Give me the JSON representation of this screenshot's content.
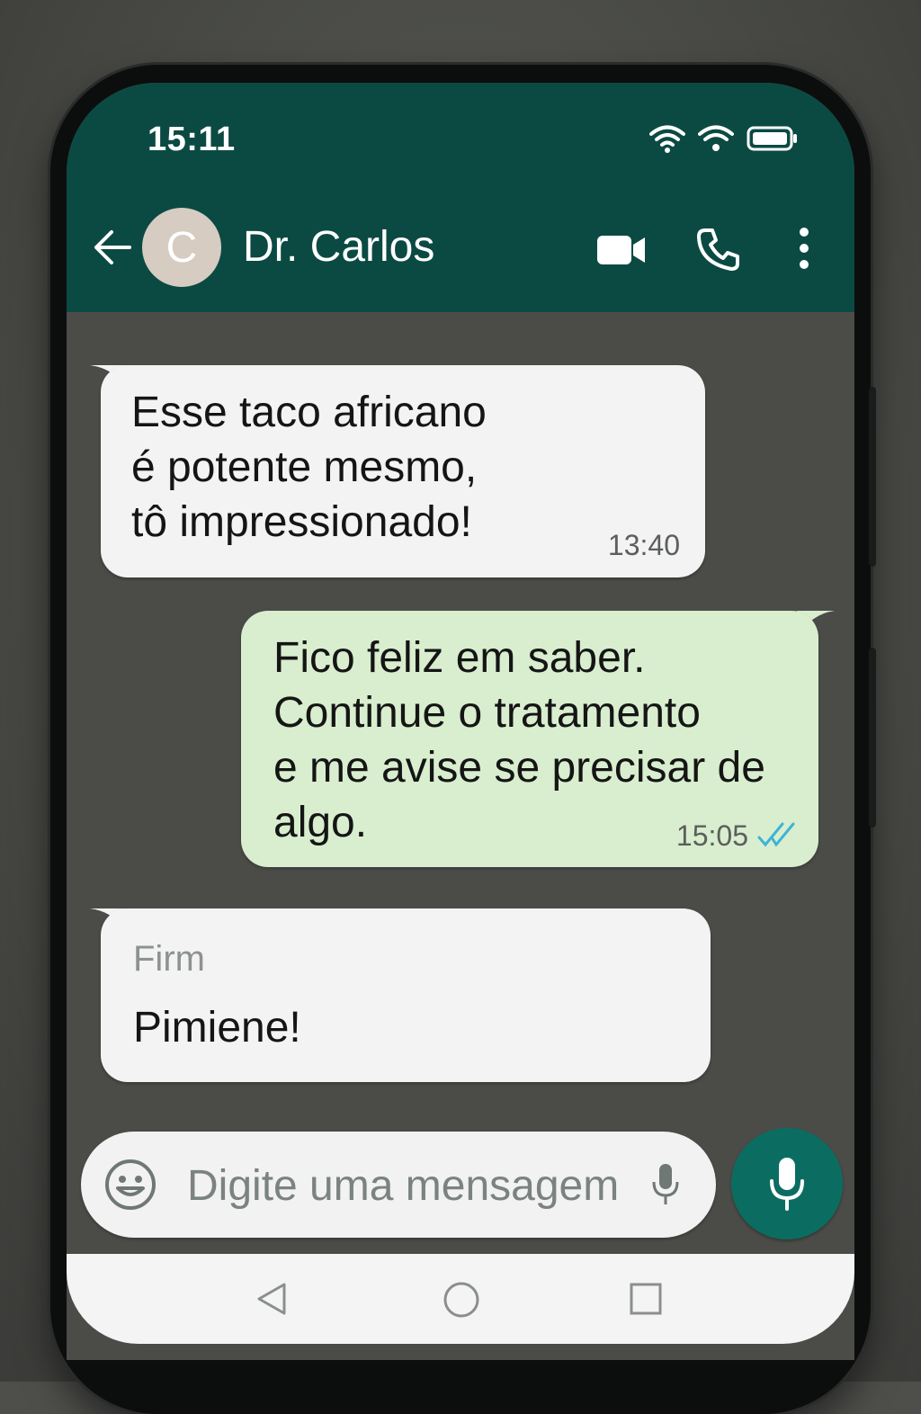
{
  "status_bar": {
    "time": "15:11"
  },
  "header": {
    "avatar_letter": "C",
    "contact_name": "Dr. Carlos",
    "icons": [
      "back-arrow-icon",
      "video-call-icon",
      "voice-call-icon",
      "more-options-icon"
    ]
  },
  "messages": [
    {
      "direction": "incoming",
      "text": "Esse taco africano\né potente mesmo,\ntô impressionado!",
      "time": "13:40"
    },
    {
      "direction": "outgoing",
      "text": "Fico feliz em saber.\nContinue o tratamento\ne me avise se precisar de\nalgo.",
      "time": "15:05",
      "status": "read"
    },
    {
      "direction": "incoming",
      "sender": "Firm",
      "text": "Pimiene!"
    }
  ],
  "composer": {
    "placeholder": "Digite uma mensagem"
  },
  "colors": {
    "header": "#0b4a43",
    "chat_background": "#4b4c48",
    "incoming_bubble": "#f3f3f3",
    "outgoing_bubble": "#d8eecf",
    "mic_button": "#0b6d61",
    "read_ticks": "#3fb3d6"
  }
}
